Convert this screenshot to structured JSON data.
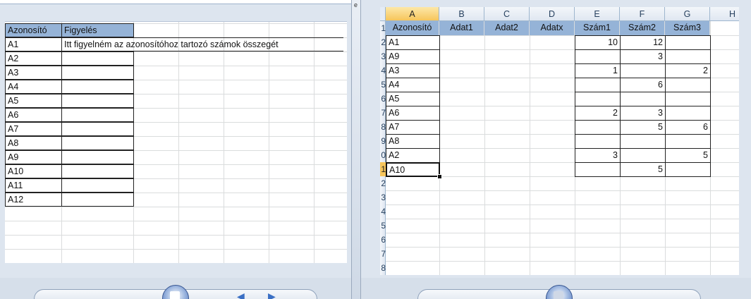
{
  "left_sheet": {
    "headers": [
      "Azonosító",
      "Figyelés"
    ],
    "rows": [
      [
        "A1",
        "Itt figyelném az azonosítóhoz tartozó számok összegét"
      ],
      [
        "A2",
        ""
      ],
      [
        "A3",
        ""
      ],
      [
        "A4",
        ""
      ],
      [
        "A5",
        ""
      ],
      [
        "A6",
        ""
      ],
      [
        "A7",
        ""
      ],
      [
        "A8",
        ""
      ],
      [
        "A9",
        ""
      ],
      [
        "A10",
        ""
      ],
      [
        "A11",
        ""
      ],
      [
        "A12",
        ""
      ]
    ]
  },
  "right_sheet": {
    "column_letters": [
      "A",
      "B",
      "C",
      "D",
      "E",
      "F",
      "G",
      "H"
    ],
    "row_numbers": [
      "1",
      "2",
      "3",
      "4",
      "5",
      "6",
      "7",
      "8",
      "9",
      "0",
      "1",
      "2",
      "3",
      "4",
      "5",
      "6",
      "7",
      "8"
    ],
    "selected_column": "A",
    "headers": [
      "Azonosító",
      "Adat1",
      "Adat2",
      "Adatx",
      "Szám1",
      "Szám2",
      "Szám3"
    ],
    "rows": [
      [
        "A1",
        "",
        "",
        "",
        "10",
        "12",
        ""
      ],
      [
        "A9",
        "",
        "",
        "",
        "",
        "3",
        ""
      ],
      [
        "A3",
        "",
        "",
        "",
        "1",
        "",
        "2"
      ],
      [
        "A4",
        "",
        "",
        "",
        "",
        "6",
        ""
      ],
      [
        "A5",
        "",
        "",
        "",
        "",
        "",
        ""
      ],
      [
        "A6",
        "",
        "",
        "",
        "2",
        "3",
        ""
      ],
      [
        "A7",
        "",
        "",
        "",
        "",
        "5",
        "6"
      ],
      [
        "A8",
        "",
        "",
        "",
        "",
        "",
        ""
      ],
      [
        "A2",
        "",
        "",
        "",
        "3",
        "",
        "5"
      ],
      [
        "A10",
        "",
        "",
        "",
        "",
        "5",
        ""
      ]
    ],
    "active_cell": "A10"
  },
  "colors": {
    "header_fill": "#95b3d7",
    "selected_header": "#f6c55b",
    "gridline": "#dadcdd"
  }
}
